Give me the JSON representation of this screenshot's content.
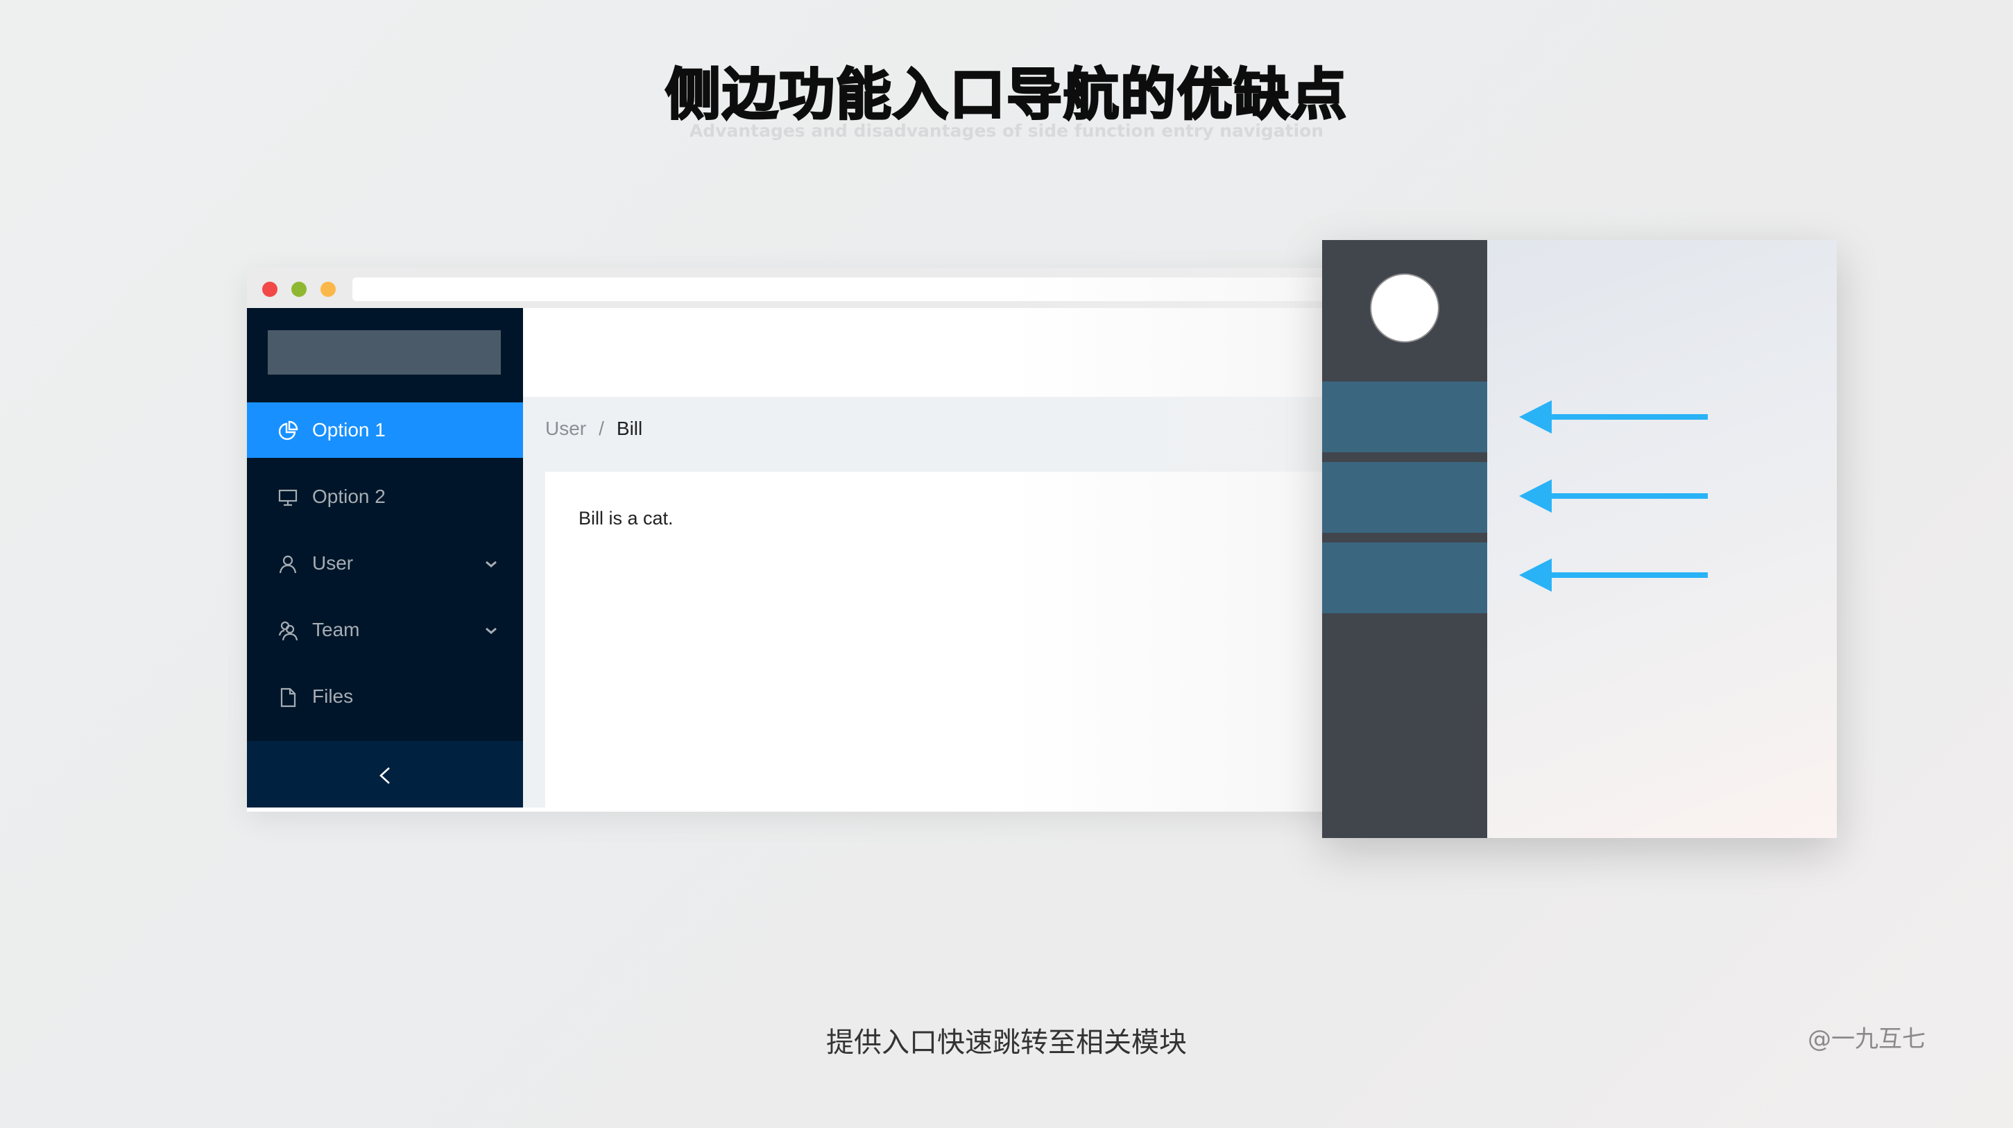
{
  "slide": {
    "title": "侧边功能入口导航的优缺点",
    "subtitle": "Advantages and disadvantages of side function entry navigation",
    "caption": "提供入口快速跳转至相关模块",
    "credit": "@一九互七"
  },
  "browser": {
    "window_controls": [
      "close",
      "minimize",
      "maximize"
    ],
    "sidebar": {
      "items": [
        {
          "label": "Option 1",
          "icon": "pie-chart-icon",
          "active": true,
          "has_submenu": false
        },
        {
          "label": "Option 2",
          "icon": "desktop-icon",
          "active": false,
          "has_submenu": false
        },
        {
          "label": "User",
          "icon": "user-icon",
          "active": false,
          "has_submenu": true
        },
        {
          "label": "Team",
          "icon": "team-icon",
          "active": false,
          "has_submenu": true
        },
        {
          "label": "Files",
          "icon": "file-icon",
          "active": false,
          "has_submenu": false
        }
      ],
      "collapse_icon": "chevron-left-icon"
    },
    "breadcrumb": {
      "items": [
        "User",
        "Bill"
      ],
      "separator": "/"
    },
    "content": {
      "text": "Bill is a cat."
    }
  },
  "illustration": {
    "rail_blocks": 3,
    "arrows": 3,
    "colors": {
      "rail": "#41464d",
      "block": "#3b6680",
      "arrow": "#29b2f6",
      "active_menu": "#1890ff",
      "sidebar": "#001529"
    }
  }
}
